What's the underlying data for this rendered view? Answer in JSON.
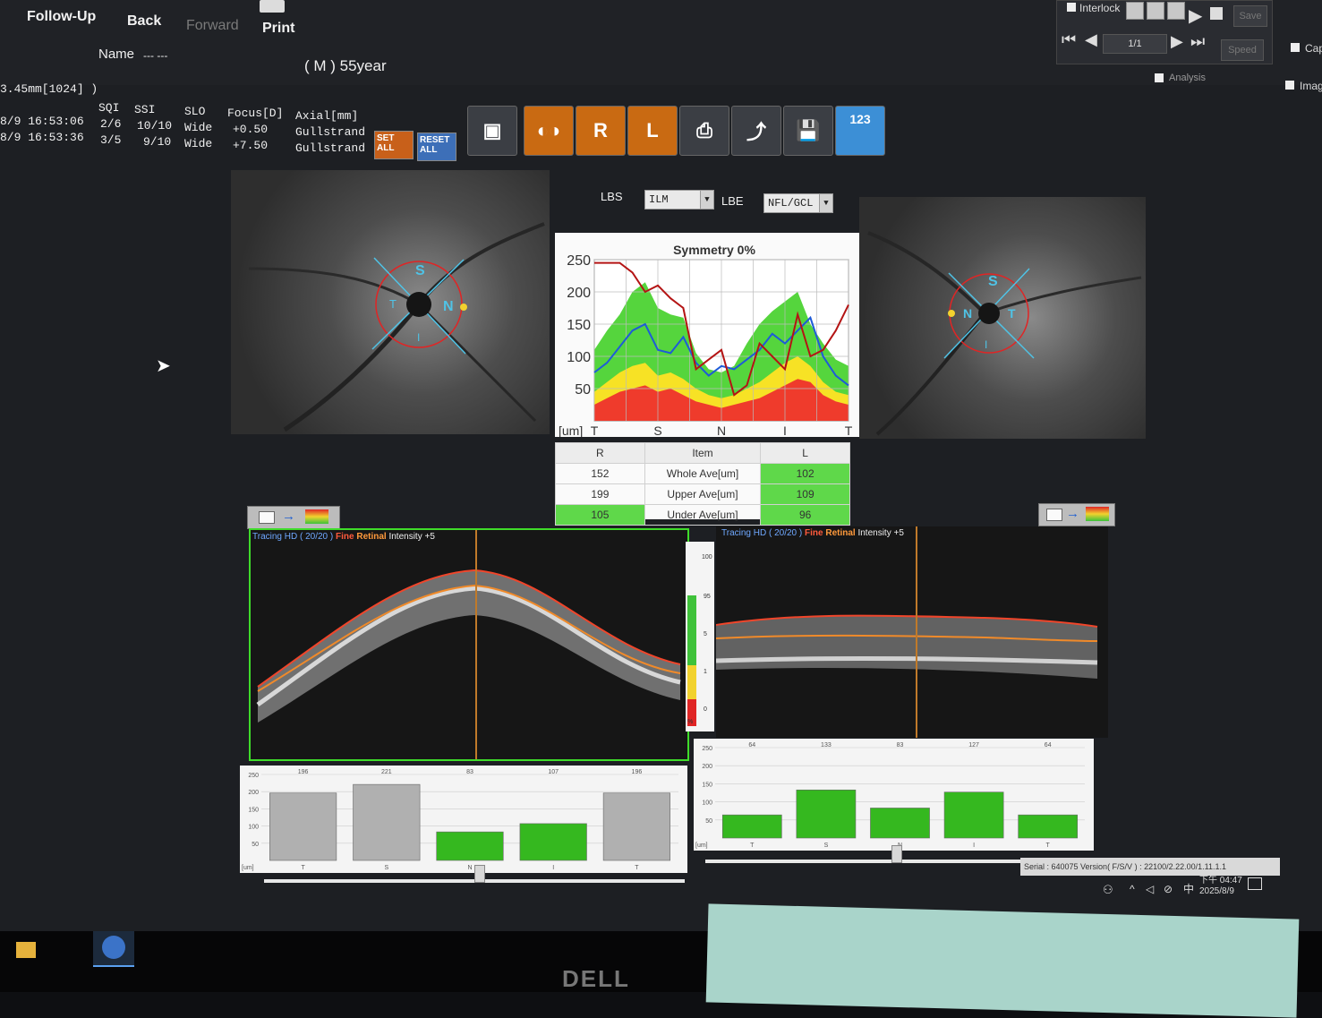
{
  "toolbar": {
    "followup": "Follow-Up",
    "back": "Back",
    "forward": "Forward",
    "print": "Print",
    "interlock": "Interlock",
    "page_indicator": "1/1",
    "save": "Save",
    "speed": "Speed",
    "analysis": "Analysis",
    "cap": "Cap",
    "imag": "Imag"
  },
  "patient": {
    "name_label": "Name",
    "name_value": "--- ---",
    "sex_age": "( M ) 55year"
  },
  "scan_info": {
    "scan_line": "3.45mm[1024] )",
    "columns": [
      "SQI",
      "SSI",
      "SLO",
      "Focus[D]",
      "Axial[mm]"
    ],
    "rows": [
      {
        "time": "8/9 16:53:06",
        "sqi": "2/6",
        "ssi": "10/10",
        "slo": "Wide",
        "focus": "+0.50",
        "axial": "Gullstrand"
      },
      {
        "time": "8/9 16:53:36",
        "sqi": "3/5",
        "ssi": "9/10",
        "slo": "Wide",
        "focus": "+7.50",
        "axial": "Gullstrand"
      }
    ],
    "set_all": "SET ALL",
    "reset_all": "RESET ALL"
  },
  "icon_buttons": [
    "R",
    "L",
    "123"
  ],
  "boundaries": {
    "lbs_label": "LBS",
    "lbs_value": "ILM",
    "lbe_label": "LBE",
    "lbe_value": "NFL/GCL"
  },
  "fundus_labels": {
    "right": [
      "S",
      "T",
      "N",
      "I"
    ],
    "left": [
      "S",
      "N",
      "T",
      "I"
    ]
  },
  "symmetry_chart": {
    "title": "Symmetry 0%",
    "unit": "[um]"
  },
  "chart_data": {
    "type": "line",
    "title": "Symmetry 0%",
    "ylabel": "[um]",
    "ylim": [
      0,
      250
    ],
    "yticks": [
      50,
      100,
      150,
      200,
      250
    ],
    "x_tick_labels": [
      "T",
      "S",
      "N",
      "I",
      "T"
    ],
    "grid": true,
    "series": [
      {
        "color": "#1e5bd8",
        "values": [
          75,
          90,
          115,
          140,
          150,
          110,
          105,
          130,
          90,
          70,
          85,
          80,
          95,
          110,
          135,
          120,
          140,
          160,
          100,
          70,
          55
        ]
      },
      {
        "color": "#b41414",
        "values": [
          245,
          245,
          245,
          230,
          200,
          210,
          190,
          175,
          80,
          95,
          110,
          40,
          55,
          120,
          100,
          80,
          165,
          100,
          110,
          140,
          180
        ]
      }
    ],
    "normative_bands": {
      "x_count": 21,
      "red_top": [
        25,
        35,
        45,
        50,
        55,
        45,
        50,
        40,
        30,
        25,
        20,
        25,
        30,
        35,
        45,
        55,
        65,
        60,
        40,
        30,
        25
      ],
      "yellow_top": [
        45,
        60,
        75,
        85,
        90,
        70,
        75,
        65,
        50,
        40,
        35,
        40,
        50,
        60,
        75,
        90,
        100,
        85,
        60,
        45,
        40
      ],
      "green_top": [
        110,
        140,
        165,
        200,
        215,
        175,
        165,
        160,
        105,
        80,
        75,
        85,
        120,
        150,
        170,
        185,
        200,
        150,
        120,
        95,
        85
      ],
      "colors": [
        "#ef3b2c",
        "#f7e225",
        "#55d53d"
      ]
    }
  },
  "comparison_table": {
    "headers": [
      "R",
      "Item",
      "L"
    ],
    "rows": [
      {
        "r": "152",
        "item": "Whole Ave[um]",
        "l": "102"
      },
      {
        "r": "199",
        "item": "Upper Ave[um]",
        "l": "109"
      },
      {
        "r": "105",
        "item": "Under Ave[um]",
        "l": "96"
      }
    ]
  },
  "oct_right": {
    "tracing": "Tracing HD ( 20/20 )",
    "fine": "Fine",
    "retinal": "Retinal",
    "intensity": "Intensity +5"
  },
  "oct_left": {
    "tracing": "Tracing HD ( 20/20 )",
    "fine": "Fine",
    "retinal": "Retinal",
    "intensity": "Intensity +5"
  },
  "scale": [
    "100",
    "95",
    "5",
    "1",
    "0",
    "%"
  ],
  "sector_bars_right": {
    "labels": [
      "T",
      "S",
      "N",
      "I",
      "T"
    ],
    "values": [
      196,
      221,
      83,
      107,
      196
    ],
    "colors": [
      "#b0b0b0",
      "#b0b0b0",
      "#35b81f",
      "#35b81f",
      "#b0b0b0"
    ],
    "yticks": [
      "250",
      "200",
      "150",
      "100",
      "50",
      "[um]"
    ]
  },
  "sector_bars_left": {
    "labels": [
      "T",
      "S",
      "N",
      "I",
      "T"
    ],
    "values": [
      64,
      133,
      83,
      127,
      64
    ],
    "colors": [
      "#35b81f",
      "#35b81f",
      "#35b81f",
      "#35b81f",
      "#35b81f"
    ],
    "yticks": [
      "250",
      "200",
      "150",
      "100",
      "50",
      "[um]"
    ]
  },
  "status_bar": {
    "serial": "Serial : 640075  Version( F/S/V ) : 22100/2.22.00/1.11.1.1",
    "time": "下午 04:47",
    "date": "2025/8/9",
    "ime": "中"
  },
  "monitor_brand": "DELL"
}
